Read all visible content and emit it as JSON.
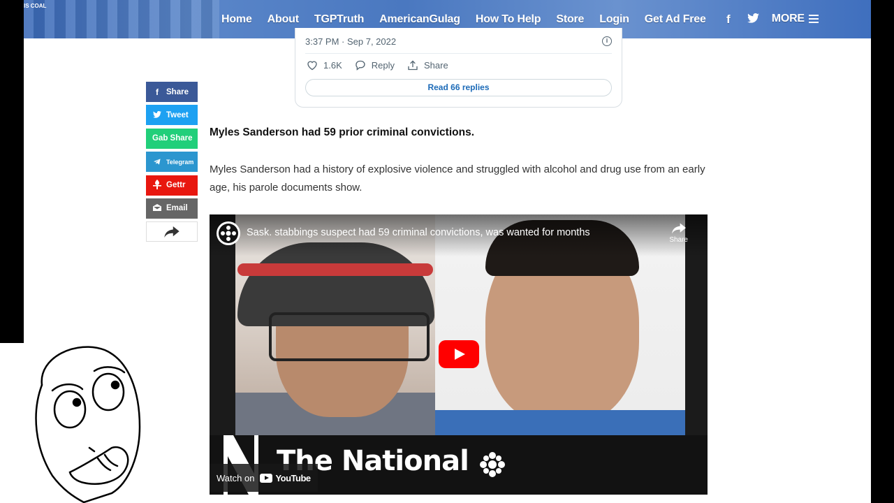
{
  "nav": {
    "site_tag": "IS COAL",
    "items": [
      "Home",
      "About",
      "TGPTruth",
      "AmericanGulag",
      "How To Help",
      "Store",
      "Login",
      "Get Ad Free"
    ],
    "facebook_icon": "f",
    "twitter_icon": "twitter-bird",
    "more_label": "MORE"
  },
  "tweet": {
    "timestamp": "3:37 PM · Sep 7, 2022",
    "likes": "1.6K",
    "reply_label": "Reply",
    "share_label": "Share",
    "read_replies": "Read 66 replies"
  },
  "share_buttons": [
    {
      "label": "Share",
      "icon": "f",
      "color": "#3b5998"
    },
    {
      "label": "Tweet",
      "icon": "twitter-bird",
      "color": "#1da1f2"
    },
    {
      "label": "Gab Share",
      "icon": "",
      "color": "#21cf7a"
    },
    {
      "label": "Telegram",
      "icon": "paper-plane",
      "color": "#2c96cf"
    },
    {
      "label": "Gettr",
      "icon": "gettr",
      "color": "#e8170f"
    },
    {
      "label": "Email",
      "icon": "envelope",
      "color": "#666666"
    }
  ],
  "article": {
    "subheading": "Myles Sanderson had 59 prior criminal convictions.",
    "paragraph": "Myles Sanderson had a history of explosive violence and struggled with alcohol and drug use from an early age, his parole documents show."
  },
  "video": {
    "title": "Sask. stabbings suspect had 59 criminal convictions, was wanted for months",
    "share_label": "Share",
    "brand": "The National",
    "watch_on": "Watch on",
    "youtube": "YouTube",
    "play_color": "#ff0000"
  }
}
